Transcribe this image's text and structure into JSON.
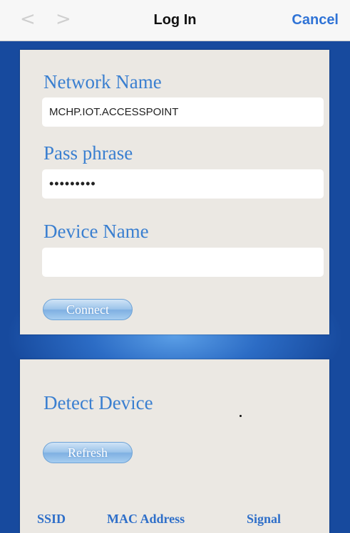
{
  "nav": {
    "title": "Log In",
    "cancel_label": "Cancel",
    "back_glyph": "<",
    "forward_glyph": ">"
  },
  "login": {
    "network_name": {
      "label": "Network Name",
      "value": "MCHP.IOT.ACCESSPOINT"
    },
    "pass_phrase": {
      "label": "Pass phrase",
      "value": "•••••••••"
    },
    "device_name": {
      "label": "Device Name",
      "value": ""
    },
    "connect_label": "Connect"
  },
  "detect": {
    "title": "Detect Device",
    "refresh_label": "Refresh",
    "columns": [
      "SSID",
      "MAC Address",
      "Signal"
    ]
  },
  "colors": {
    "accent": "#3a7fd0",
    "background": "#174a9e",
    "panel": "#ebe8e3"
  }
}
